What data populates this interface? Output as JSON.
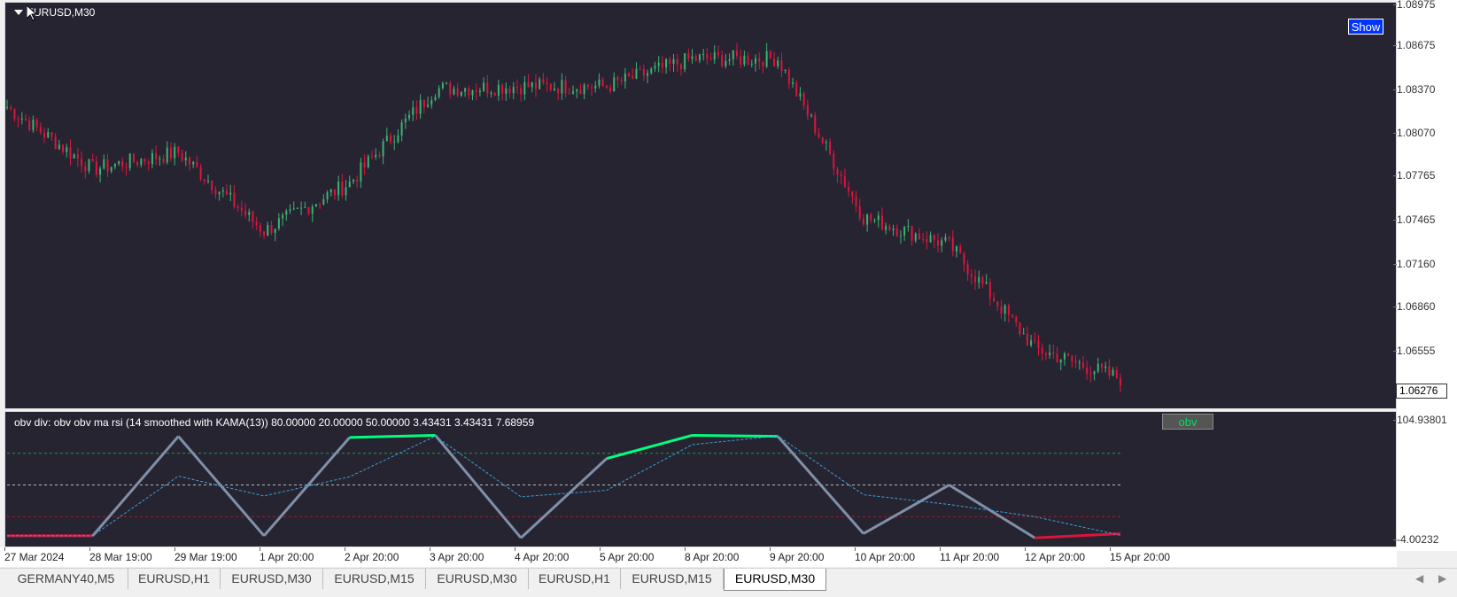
{
  "window": {
    "symbol_title": "EURUSD,M30",
    "show_button": "Show"
  },
  "price_scale": {
    "ticks": [
      "1.08975",
      "1.08675",
      "1.08370",
      "1.08070",
      "1.07765",
      "1.07465",
      "1.07160",
      "1.06860",
      "1.06555"
    ],
    "current_price": "1.06276"
  },
  "indicator": {
    "label": "obv div: obv obv ma rsi (14 smoothed with KAMA(13)) 80.00000 20.00000 50.00000 3.43431 3.43431 7.68959",
    "button": "obv",
    "scale_top": "104.93801",
    "scale_bottom": "-4.00232"
  },
  "time_axis": [
    "27 Mar 2024",
    "28 Mar 19:00",
    "29 Mar 19:00",
    "1 Apr 20:00",
    "2 Apr 20:00",
    "3 Apr 20:00",
    "4 Apr 20:00",
    "5 Apr 20:00",
    "8 Apr 20:00",
    "9 Apr 20:00",
    "10 Apr 20:00",
    "11 Apr 20:00",
    "12 Apr 20:00",
    "15 Apr 20:00"
  ],
  "tabs": [
    {
      "label": "GERMANY40,M5"
    },
    {
      "label": "EURUSD,H1"
    },
    {
      "label": "EURUSD,M30"
    },
    {
      "label": "EURUSD,M15"
    },
    {
      "label": "EURUSD,M30"
    },
    {
      "label": "EURUSD,H1"
    },
    {
      "label": "EURUSD,M15"
    },
    {
      "label": "EURUSD,M30",
      "active": true
    }
  ],
  "colors": {
    "background": "#272432",
    "bull_candle": "#3cb371",
    "bear_candle": "#dc143c",
    "obv_up": "#00ff7f",
    "obv_down": "#dc143c",
    "obv_neutral": "#8090a8",
    "obv_ma": "#39a3d6",
    "show_button": "#0033ff"
  },
  "chart_data": {
    "type": "line",
    "panes": [
      {
        "name": "EURUSD,M30",
        "type": "candlestick",
        "x": [
          "27 Mar 2024",
          "28 Mar 19:00",
          "29 Mar 19:00",
          "1 Apr 20:00",
          "2 Apr 20:00",
          "3 Apr 20:00",
          "4 Apr 20:00",
          "5 Apr 20:00",
          "8 Apr 20:00",
          "9 Apr 20:00",
          "10 Apr 20:00",
          "11 Apr 20:00",
          "12 Apr 20:00",
          "15 Apr 20:00"
        ],
        "close": [
          1.0825,
          1.078,
          1.0792,
          1.0735,
          1.077,
          1.0838,
          1.084,
          1.084,
          1.086,
          1.086,
          1.0745,
          1.0725,
          1.065,
          1.0628
        ],
        "ylim": [
          1.062,
          1.09
        ]
      },
      {
        "name": "obv",
        "type": "line",
        "values": [
          2,
          2,
          96,
          2,
          95,
          97,
          0,
          75,
          97,
          96,
          4,
          50,
          0,
          4
        ],
        "levels": [
          80,
          50,
          20
        ],
        "ylim": [
          -4.00232,
          104.93801
        ]
      }
    ]
  }
}
